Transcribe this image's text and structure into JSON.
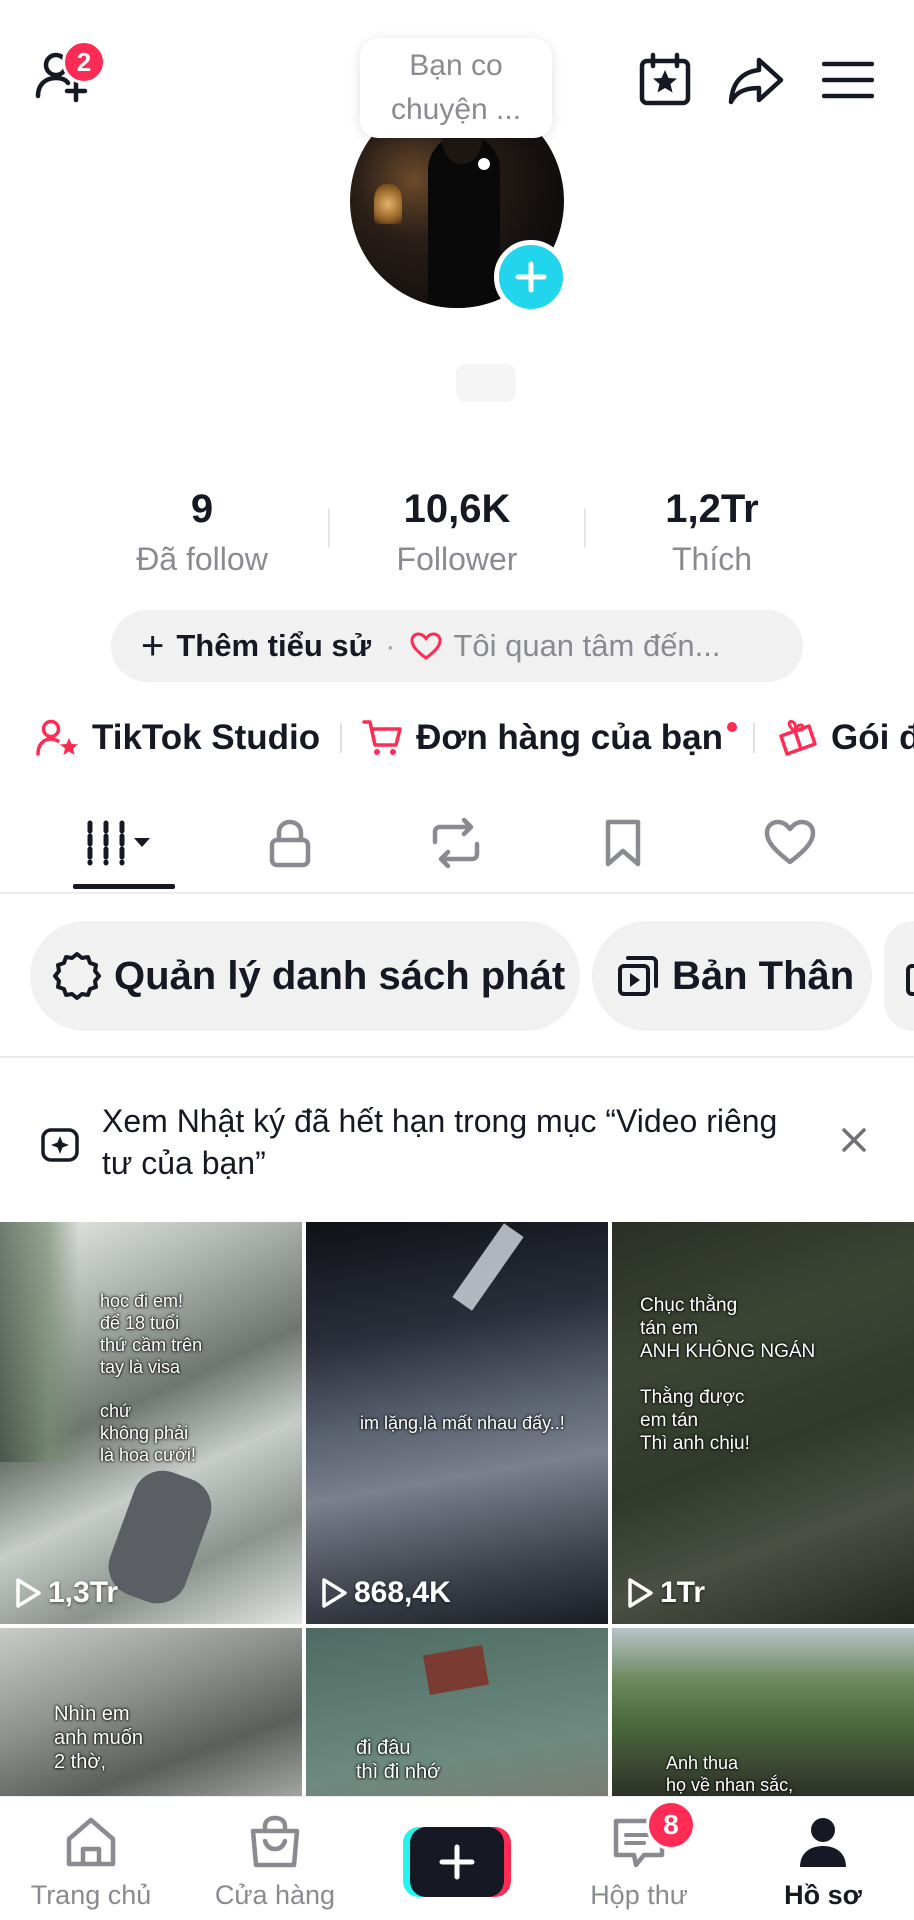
{
  "header": {
    "friend_badge": "2",
    "speech_bubble_text": "Bạn co\nchuyện ..."
  },
  "stats": [
    {
      "value": "9",
      "label": "Đã follow"
    },
    {
      "value": "10,6K",
      "label": "Follower"
    },
    {
      "value": "1,2Tr",
      "label": "Thích"
    }
  ],
  "bio": {
    "add_label": "Thêm tiểu sử",
    "separator": "·",
    "interest_label": "Tôi quan tâm đến..."
  },
  "quick_links": [
    {
      "label": "TikTok Studio",
      "icon": "person-star-icon"
    },
    {
      "label": "Đơn hàng của bạn",
      "icon": "cart-icon",
      "has_dot": true
    },
    {
      "label": "Gói đ",
      "icon": "gift-icon"
    }
  ],
  "tabs": [
    {
      "name": "videos",
      "icon": "grid-icon",
      "active": true
    },
    {
      "name": "private",
      "icon": "lock-icon"
    },
    {
      "name": "reposts",
      "icon": "repost-icon"
    },
    {
      "name": "saved",
      "icon": "bookmark-icon"
    },
    {
      "name": "liked",
      "icon": "heart-icon"
    }
  ],
  "playlists": {
    "manage_label": "Quản lý danh sách phát",
    "playlist_label": "Bản Thân"
  },
  "notice": {
    "text": "Xem Nhật ký đã hết hạn trong mục “Video riêng tư của bạn”"
  },
  "videos": [
    {
      "views": "1,3Tr",
      "caption": "học đi em!\nđể 18 tuổi\nthứ cầm trên\ntay là visa\n\nchứ\nkhông phải\nlà hoa cưới!"
    },
    {
      "views": "868,4K",
      "caption": "im lặng,là mất nhau đấy..!"
    },
    {
      "views": "1Tr",
      "caption": "Chục thằng\ntán em\nANH KHÔNG NGÁN\n\nThằng được\nem tán\nThì anh chịu!"
    },
    {
      "views": "",
      "caption": "Nhìn em\nanh muốn\n2 thờ,"
    },
    {
      "views": "",
      "caption": "đi đâu\nthì đi nhớ"
    },
    {
      "views": "",
      "caption": "Anh thua\nhọ về nhan sắc,"
    }
  ],
  "bottom_nav": {
    "home": "Trang chủ",
    "shop": "Cửa hàng",
    "inbox": "Hộp thư",
    "inbox_badge": "8",
    "profile": "Hồ sơ"
  },
  "colors": {
    "accent": "#fe2c55",
    "cyan": "#25f4ee",
    "avatar_add": "#20d5ec",
    "text_primary": "#161823",
    "text_secondary": "#8a8b91"
  }
}
